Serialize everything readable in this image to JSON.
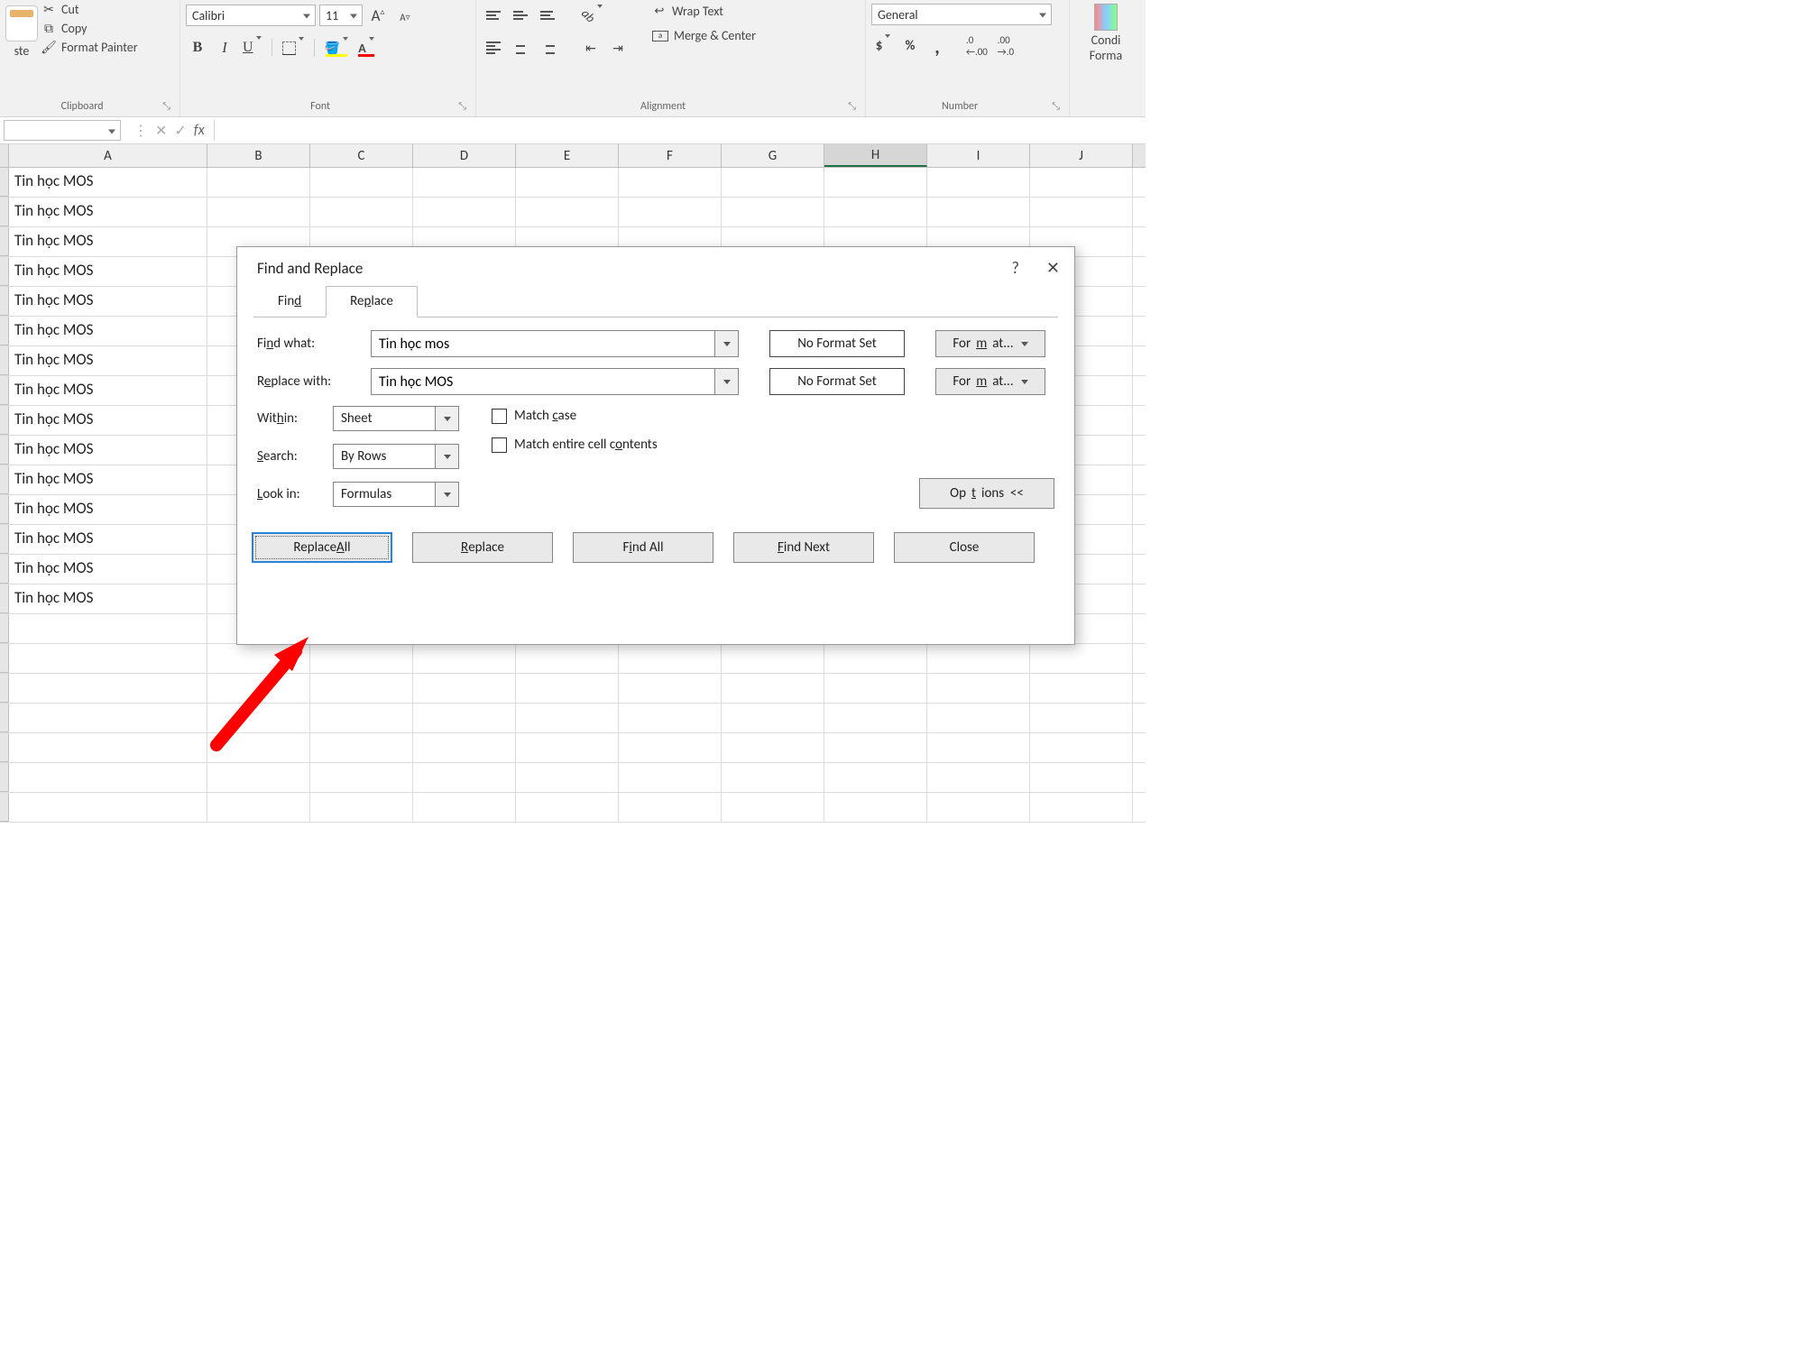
{
  "ribbon": {
    "clipboard": {
      "label": "Clipboard",
      "paste": "ste",
      "cut": "Cut",
      "copy": "Copy",
      "format_painter": "Format Painter"
    },
    "font": {
      "label": "Font",
      "name": "Calibri",
      "size": "11",
      "bold": "B",
      "italic": "I",
      "underline": "U"
    },
    "alignment": {
      "label": "Alignment",
      "wrap": "Wrap Text",
      "merge": "Merge & Center"
    },
    "number": {
      "label": "Number",
      "format": "General",
      "currency": "$",
      "percent": "%",
      "comma": ","
    },
    "styles": {
      "conditional": "Condi",
      "formatting": "Forma"
    }
  },
  "columns": [
    "A",
    "B",
    "C",
    "D",
    "E",
    "F",
    "G",
    "H",
    "I",
    "J"
  ],
  "selected_column": "H",
  "cell_content": "Tin học MOS",
  "row_count": 22,
  "filled_rows": 15,
  "dialog": {
    "title": "Find and Replace",
    "tab_find": "Find",
    "tab_replace": "Replace",
    "find_what_label": "Find what:",
    "find_what_value": "Tin học mos",
    "replace_with_label": "Replace with:",
    "replace_with_value": "Tin học MOS",
    "no_format": "No Format Set",
    "format_btn": "Format...",
    "within_label": "Within:",
    "within_value": "Sheet",
    "search_label": "Search:",
    "search_value": "By Rows",
    "lookin_label": "Look in:",
    "lookin_value": "Formulas",
    "match_case": "Match case",
    "match_entire": "Match entire cell contents",
    "options": "Options <<",
    "replace_all": "Replace All",
    "replace": "Replace",
    "find_all": "Find All",
    "find_next": "Find Next",
    "close": "Close"
  }
}
